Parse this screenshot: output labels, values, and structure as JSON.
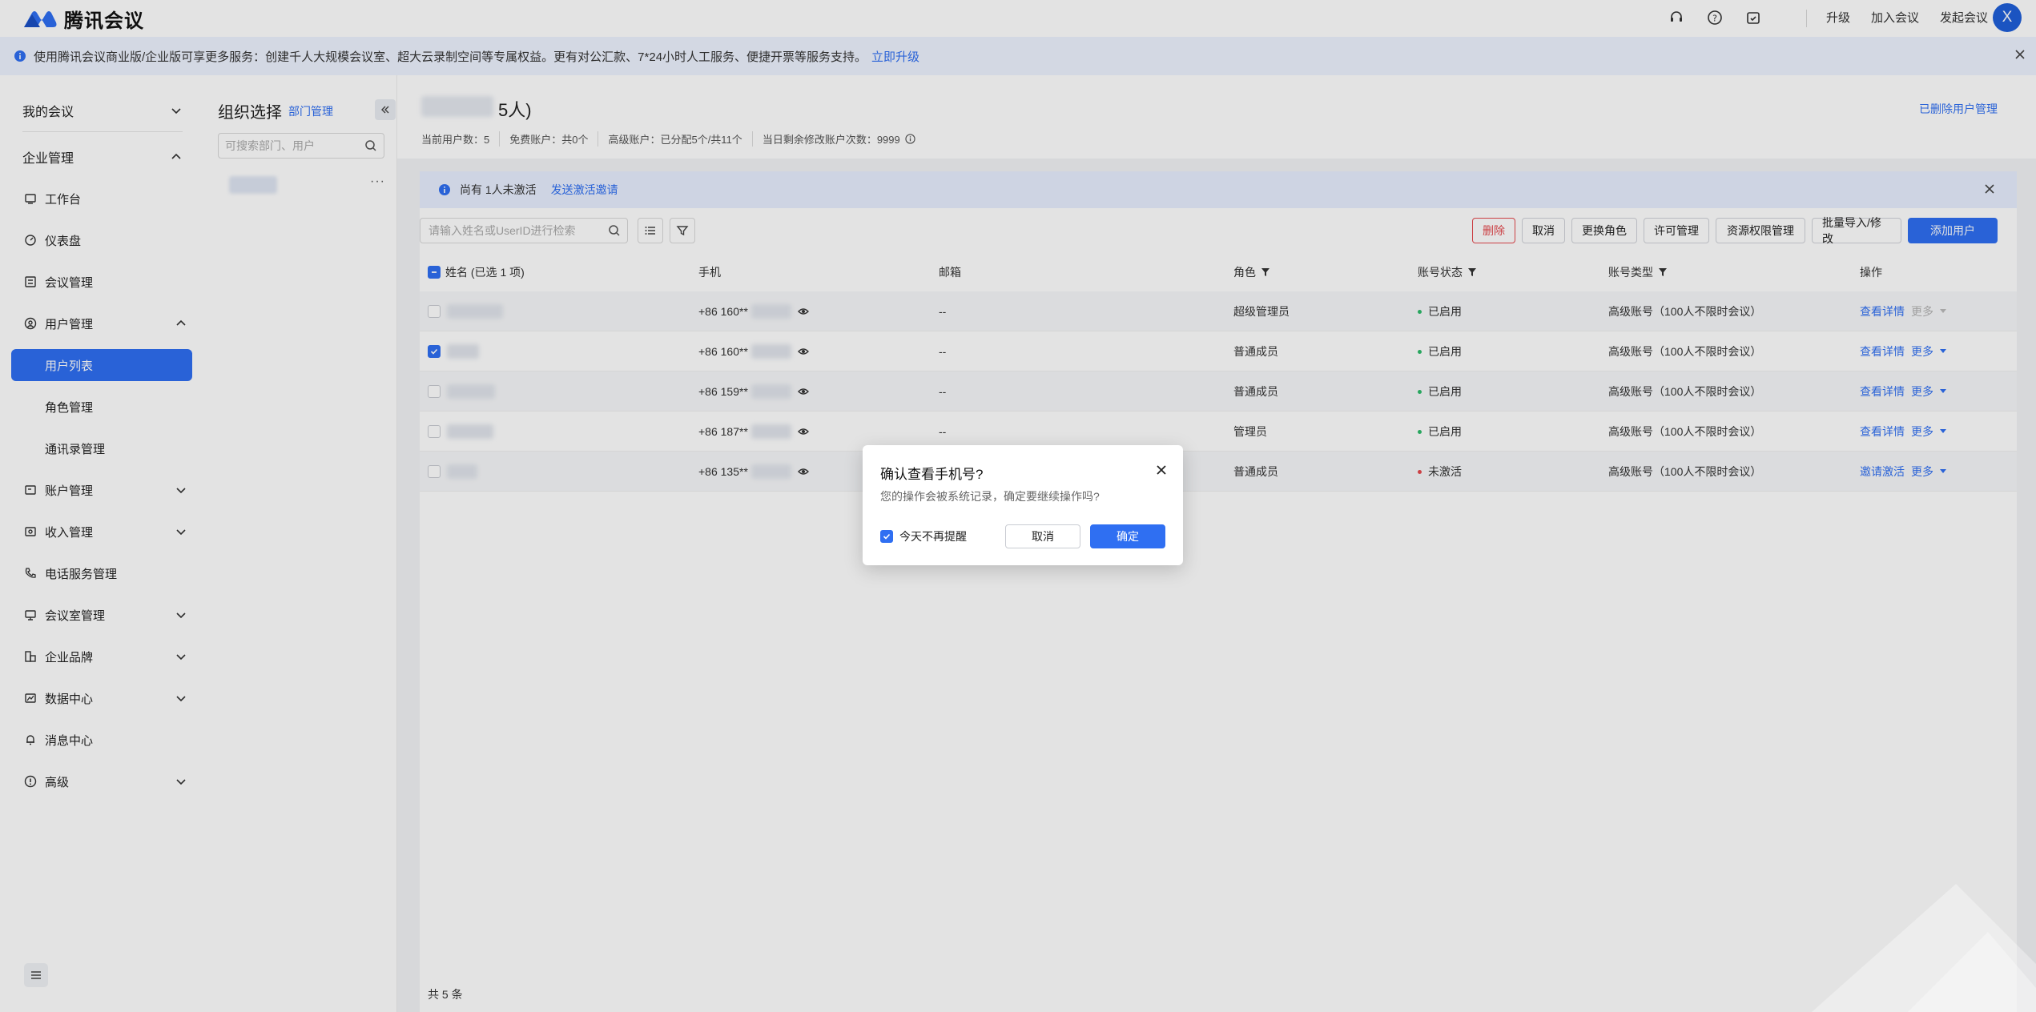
{
  "app": {
    "title": "腾讯会议"
  },
  "header": {
    "links": [
      "升级",
      "加入会议",
      "发起会议"
    ],
    "avatar_letter": "X"
  },
  "notice": {
    "text": "使用腾讯会议商业版/企业版可享更多服务：创建千人大规模会议室、超大云录制空间等专属权益。更有对公汇款、7*24小时人工服务、便捷开票等服务支持。",
    "link": "立即升级"
  },
  "sidebar": {
    "my_meetings": "我的会议",
    "enterprise": "企业管理",
    "items": [
      {
        "label": "工作台",
        "icon": "workbench-icon"
      },
      {
        "label": "仪表盘",
        "icon": "dashboard-icon"
      },
      {
        "label": "会议管理",
        "icon": "meeting-list-icon"
      },
      {
        "label": "用户管理",
        "icon": "user-icon"
      },
      {
        "label": "账户管理",
        "icon": "account-icon"
      },
      {
        "label": "收入管理",
        "icon": "income-icon"
      },
      {
        "label": "电话服务管理",
        "icon": "phone-icon"
      },
      {
        "label": "会议室管理",
        "icon": "room-icon"
      },
      {
        "label": "企业品牌",
        "icon": "brand-icon"
      },
      {
        "label": "数据中心",
        "icon": "data-icon"
      },
      {
        "label": "消息中心",
        "icon": "bell-icon"
      },
      {
        "label": "高级",
        "icon": "advanced-icon"
      }
    ],
    "sub_items": [
      "用户列表",
      "角色管理",
      "通讯录管理"
    ]
  },
  "org": {
    "title": "组织选择",
    "link": "部门管理",
    "search_placeholder": "可搜索部门、用户",
    "more": "···"
  },
  "main": {
    "title_suffix": "5人)",
    "deleted_link": "已删除用户管理",
    "stats": [
      "当前用户数：5",
      "免费账户：共0个",
      "高级账户：已分配5个/共11个",
      "当日剩余修改账户次数：9999"
    ],
    "alert": {
      "text": "尚有 1人未激活",
      "link": "发送激活邀请"
    },
    "search_placeholder": "请输入姓名或UserID进行检索",
    "toolbar": [
      "删除",
      "取消",
      "更换角色",
      "许可管理",
      "资源权限管理",
      "批量导入/修改",
      "添加用户"
    ],
    "columns": [
      "姓名 (已选 1 项)",
      "手机",
      "邮箱",
      "角色",
      "账号状态",
      "账号类型",
      "操作"
    ],
    "rows": [
      {
        "phone": "+86 160**",
        "email": "--",
        "role": "超级管理员",
        "status": "已启用",
        "type": "高级账号（100人不限时会议）",
        "action": "查看详情",
        "more": "更多"
      },
      {
        "phone": "+86 160**",
        "email": "--",
        "role": "普通成员",
        "status": "已启用",
        "type": "高级账号（100人不限时会议）",
        "action": "查看详情",
        "more": "更多"
      },
      {
        "phone": "+86 159**",
        "email": "--",
        "role": "普通成员",
        "status": "已启用",
        "type": "高级账号（100人不限时会议）",
        "action": "查看详情",
        "more": "更多"
      },
      {
        "phone": "+86 187**",
        "email": "--",
        "role": "管理员",
        "status": "已启用",
        "type": "高级账号（100人不限时会议）",
        "action": "查看详情",
        "more": "更多"
      },
      {
        "phone": "+86 135**",
        "email": "",
        "role": "普通成员",
        "status": "未激活",
        "type": "高级账号（100人不限时会议）",
        "action": "邀请激活",
        "more": "更多"
      }
    ],
    "total": "共 5 条"
  },
  "dialog": {
    "title": "确认查看手机号?",
    "message": "您的操作会被系统记录，确定要继续操作吗?",
    "checkbox": "今天不再提醒",
    "cancel": "取消",
    "ok": "确定"
  },
  "colors": {
    "primary": "#2f6ff2",
    "danger": "#e5484d",
    "success": "#2dbb6a"
  }
}
